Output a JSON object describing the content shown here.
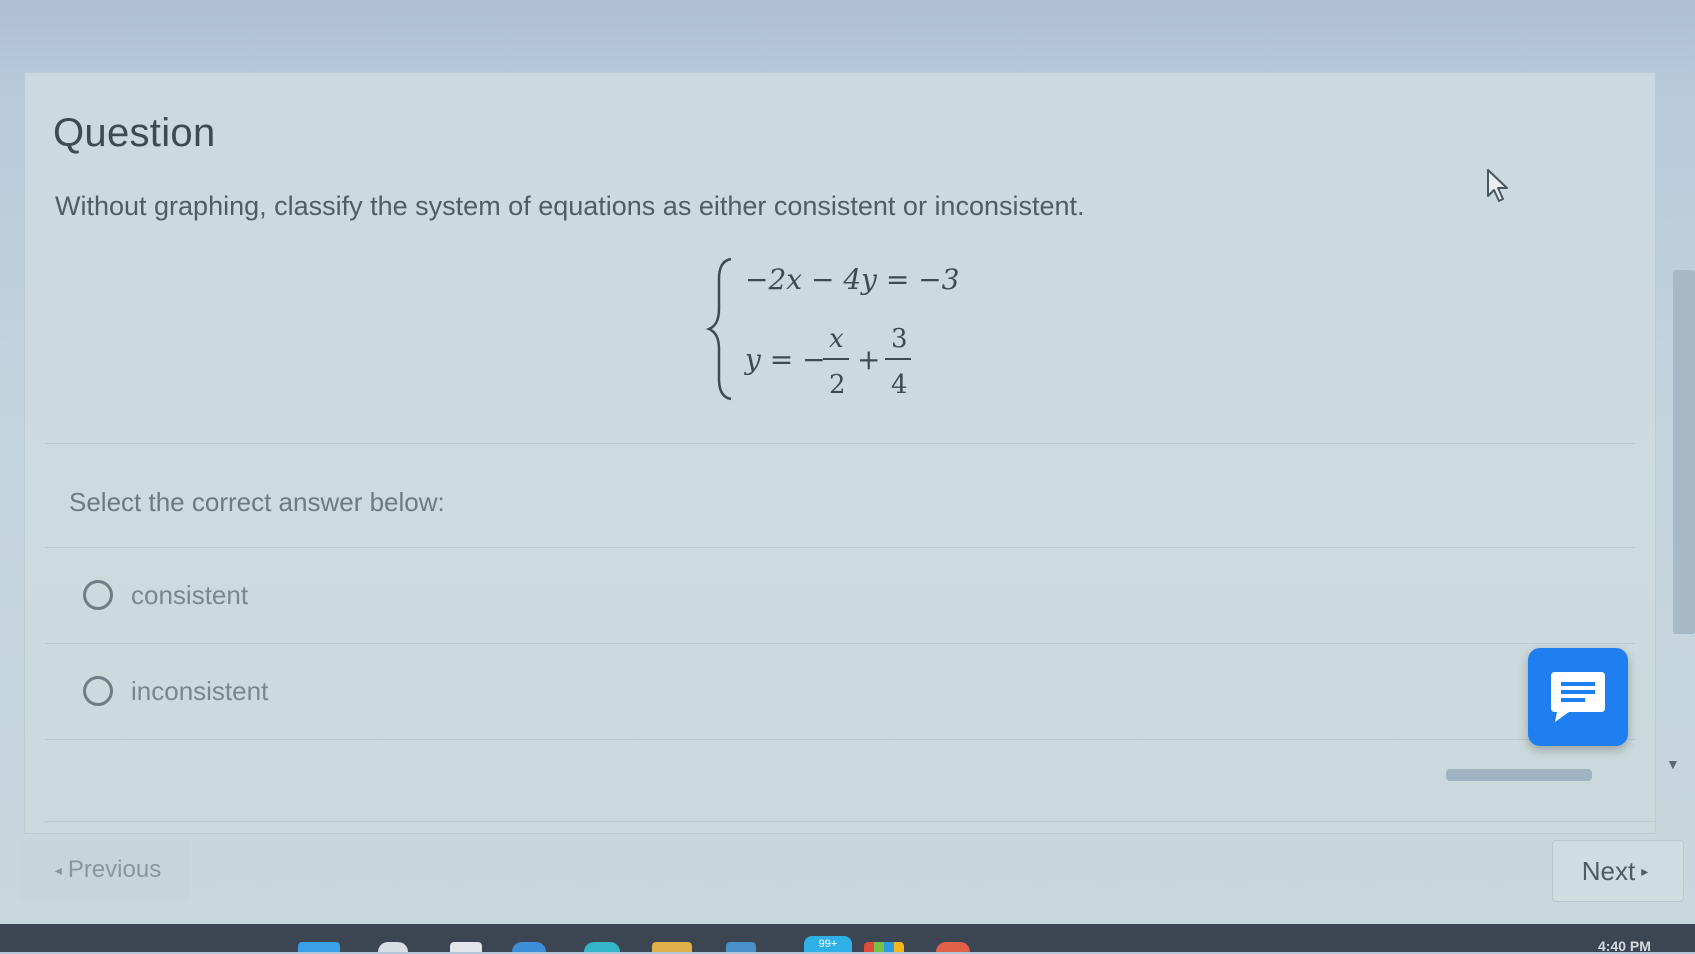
{
  "question": {
    "heading": "Question",
    "prompt": "Without graphing, classify the system of equations as either consistent or inconsistent.",
    "equations": {
      "line1": "−2x − 4y = −3",
      "line2_lhs": "y = −",
      "line2_frac1_num": "x",
      "line2_frac1_den": "2",
      "line2_plus": "+",
      "line2_frac2_num": "3",
      "line2_frac2_den": "4"
    }
  },
  "answers": {
    "instruction": "Select the correct answer below:",
    "options": [
      {
        "label": "consistent",
        "selected": false
      },
      {
        "label": "inconsistent",
        "selected": false
      }
    ]
  },
  "navigation": {
    "previous_label": "Previous",
    "next_label": "Next"
  },
  "taskbar": {
    "badge": "99+",
    "time": "4:40 PM"
  },
  "colors": {
    "chat_button": "#1f7ff0",
    "taskbar": "#3c4652",
    "background": "#c9d8de"
  },
  "icons": {
    "chat": "chat-icon",
    "cursor": "mouse-pointer-icon",
    "radio": "radio-unchecked-icon"
  }
}
